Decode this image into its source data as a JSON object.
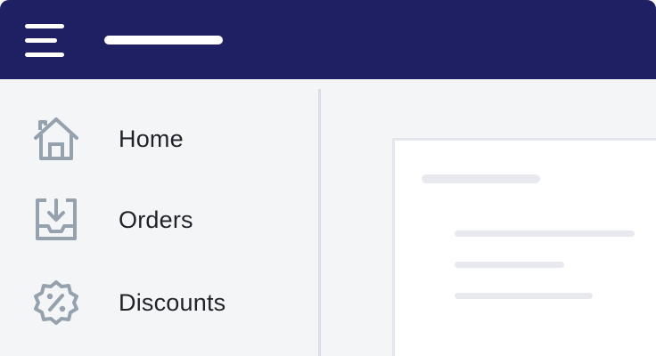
{
  "header": {
    "menu_icon": "hamburger-menu-icon",
    "background": "#1e2063"
  },
  "sidebar": {
    "items": [
      {
        "label": "Home",
        "icon": "home-icon"
      },
      {
        "label": "Orders",
        "icon": "inbox-download-icon"
      },
      {
        "label": "Discounts",
        "icon": "discount-badge-icon"
      }
    ]
  },
  "colors": {
    "icon": "#95a1ac",
    "text": "#1f2329",
    "panel": "#f4f5f7",
    "card": "#ffffff"
  }
}
